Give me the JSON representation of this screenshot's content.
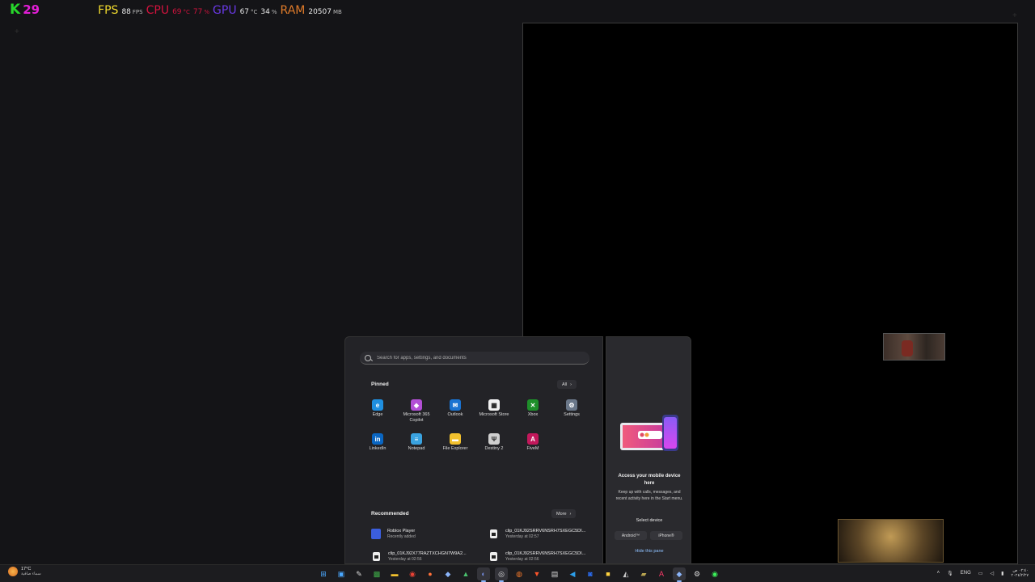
{
  "overlay": {
    "k_letter": "K",
    "k_value": "29",
    "fps_label": "FPS",
    "fps_value": "88",
    "fps_unit": "FPS",
    "cpu_label": "CPU",
    "cpu_value": "69",
    "cpu_temp_unit": "°C",
    "cpu_usage": "77",
    "cpu_usage_unit": "%",
    "gpu_label": "GPU",
    "gpu_value": "67",
    "gpu_temp_unit": "°C",
    "gpu_usage": "34",
    "gpu_usage_unit": "%",
    "ram_label": "RAM",
    "ram_value": "20507",
    "ram_unit": "MB"
  },
  "start_menu": {
    "search_placeholder": "Search for apps, settings, and documents",
    "pinned_title": "Pinned",
    "all_label": "All",
    "pinned_apps": [
      {
        "name": "Edge",
        "color": "#1f8fe0",
        "glyph": "e"
      },
      {
        "name": "Microsoft 365 Copilot",
        "color": "#b34fd6",
        "glyph": "◆"
      },
      {
        "name": "Outlook",
        "color": "#1a73d1",
        "glyph": "✉"
      },
      {
        "name": "Microsoft Store",
        "color": "#f2f2f2",
        "glyph": "▦"
      },
      {
        "name": "Xbox",
        "color": "#1e8f2a",
        "glyph": "✕"
      },
      {
        "name": "Settings",
        "color": "#6a7789",
        "glyph": "⚙"
      },
      {
        "name": "LinkedIn",
        "color": "#0a66c2",
        "glyph": "in"
      },
      {
        "name": "Notepad",
        "color": "#3aa3e0",
        "glyph": "≡"
      },
      {
        "name": "File Explorer",
        "color": "#f2c12e",
        "glyph": "▬"
      },
      {
        "name": "Destiny 2",
        "color": "#cfcfcf",
        "glyph": "Ψ"
      },
      {
        "name": "FiveM",
        "color": "#c2185b",
        "glyph": "A"
      }
    ],
    "recommended_title": "Recommended",
    "more_label": "More",
    "recommended": [
      {
        "title": "Roblox Player",
        "sub": "Recently added",
        "icon": "roblox"
      },
      {
        "title": "clip_01KJ92SRRV6NSRH7SXEGC5DI...",
        "sub": "Yesterday at 02:57",
        "icon": "file"
      },
      {
        "title": "clip_01KJ92X77RAZTXCHGN7W9A2...",
        "sub": "Yesterday at 02:56",
        "icon": "file"
      },
      {
        "title": "clip_01KJ92SRRV6NSRH7SXEGC5DI...",
        "sub": "Yesterday at 02:56",
        "icon": "file"
      }
    ]
  },
  "phone_pane": {
    "title": "Access your mobile device here",
    "subtitle": "Keep up with calls, messages, and recent activity here in the Start menu.",
    "select_label": "Select device",
    "android_label": "Android™",
    "iphone_label": "iPhone®",
    "hide_label": "Hide this pane"
  },
  "taskbar": {
    "weather_temp": "17°C",
    "weather_desc": "سماء صافية",
    "apps": [
      {
        "name": "start",
        "glyph": "⊞",
        "color": "#4aa8ff"
      },
      {
        "name": "task-view",
        "glyph": "▣",
        "color": "#4aa8ff"
      },
      {
        "name": "tool",
        "glyph": "✎",
        "color": "#ddd"
      },
      {
        "name": "minecraft",
        "glyph": "▩",
        "color": "#3fae49"
      },
      {
        "name": "folder",
        "glyph": "▬",
        "color": "#f2c12e"
      },
      {
        "name": "chrome",
        "glyph": "◉",
        "color": "#e94235"
      },
      {
        "name": "firefox",
        "glyph": "●",
        "color": "#ff7139"
      },
      {
        "name": "app-tile",
        "glyph": "◆",
        "color": "#8ab4f8"
      },
      {
        "name": "game",
        "glyph": "▲",
        "color": "#4ac16e"
      },
      {
        "name": "discord",
        "glyph": "◐",
        "color": "#7289da"
      },
      {
        "name": "obs",
        "glyph": "◎",
        "color": "#ddd"
      },
      {
        "name": "blender",
        "glyph": "◍",
        "color": "#f5792a"
      },
      {
        "name": "brave",
        "glyph": "▼",
        "color": "#fb542b"
      },
      {
        "name": "store",
        "glyph": "▤",
        "color": "#ddd"
      },
      {
        "name": "vscode",
        "glyph": "◀",
        "color": "#2c9de8"
      },
      {
        "name": "malwarebytes",
        "glyph": "◙",
        "color": "#2b6ef5"
      },
      {
        "name": "sticky",
        "glyph": "■",
        "color": "#ffd23f"
      },
      {
        "name": "net",
        "glyph": "◭",
        "color": "#ccc"
      },
      {
        "name": "stack",
        "glyph": "▰",
        "color": "#b7a350"
      },
      {
        "name": "fivem",
        "glyph": "A",
        "color": "#ff3b6b"
      },
      {
        "name": "steam",
        "glyph": "◆",
        "color": "#8ab4f8"
      },
      {
        "name": "settings",
        "glyph": "⚙",
        "color": "#ddd"
      },
      {
        "name": "razer",
        "glyph": "◉",
        "color": "#3cf05a"
      }
    ],
    "lang": "ENG",
    "time": "٠٢:٤٠ ص",
    "date": "٢٠٢٤/٢/٢٧"
  }
}
